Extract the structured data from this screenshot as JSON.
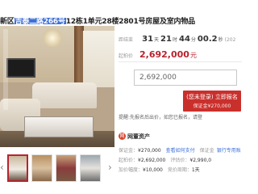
{
  "title": {
    "prefix": "新区",
    "highlight": "吉泰二路266号",
    "suffix": "12栋1单元28楼2801号房屋及室内物品"
  },
  "thumbnails": {
    "prev_arrow": "‹",
    "next_arrow": "›",
    "active_index": 0
  },
  "countdown": {
    "label": "距结束",
    "days": "31",
    "days_unit": "天",
    "hours": "21",
    "hours_unit": "时",
    "minutes": "44",
    "minutes_unit": "分",
    "seconds": "00.2",
    "seconds_unit": "秒",
    "tail": "(202"
  },
  "price": {
    "label": "起拍价",
    "value": "2,692,000",
    "unit": "元"
  },
  "bid": {
    "input_value": "2,692,000",
    "button_line1": "(您未登录) 立即报名",
    "button_line2": "保证金¥270,000"
  },
  "tip": {
    "label": "提醒:",
    "text": "先报名后出价，如您已报名，请登"
  },
  "asset": {
    "icon": "网",
    "label": "网董资产"
  },
  "info": {
    "deposit_label": "保证金：",
    "deposit_value": "¥270,000",
    "deposit_link": "查看如何支付",
    "pay_label": "保证金",
    "pay_link": "银行专用账",
    "start_label": "起拍价：",
    "start_value": "¥2,692,000",
    "assess_label": "评估价：",
    "assess_value": "¥2,990,0",
    "increment_label": "加价幅度：",
    "increment_value": "¥10,000",
    "period_label": "竞价周期：",
    "period_value": "1天"
  },
  "colors": {
    "accent": "#b8232f",
    "button": "#c9302c",
    "highlight": "#3c6fd8"
  }
}
